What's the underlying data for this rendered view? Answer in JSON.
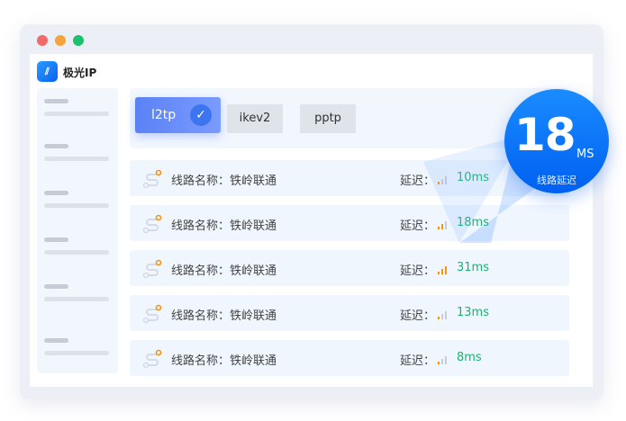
{
  "window": {
    "dots": [
      "#f16a6a",
      "#f6a33a",
      "#1dc06d"
    ]
  },
  "brand": {
    "name": "极光IP",
    "logo_icon": "slashes-icon"
  },
  "tabs": [
    {
      "label": "l2tp",
      "active": true
    },
    {
      "label": "ikev2"
    },
    {
      "label": "pptp"
    }
  ],
  "routes": [
    {
      "label": "线路名称：铁岭联通",
      "delay_label": "延迟：",
      "value": "10ms",
      "signal": 1
    },
    {
      "label": "线路名称：铁岭联通",
      "delay_label": "延迟：",
      "value": "18ms",
      "signal": 2
    },
    {
      "label": "线路名称：铁岭联通",
      "delay_label": "延迟：",
      "value": "31ms",
      "signal": 3
    },
    {
      "label": "线路名称：铁岭联通",
      "delay_label": "延迟：",
      "value": "13ms",
      "signal": 1
    },
    {
      "label": "线路名称：铁岭联通",
      "delay_label": "延迟：",
      "value": "8ms",
      "signal": 1
    }
  ],
  "badge": {
    "value": "18",
    "unit": "MS",
    "caption": "线路延迟"
  },
  "colors": {
    "accent": "#0a6cf5",
    "good": "#12b86a",
    "signal": "#f7930f"
  }
}
